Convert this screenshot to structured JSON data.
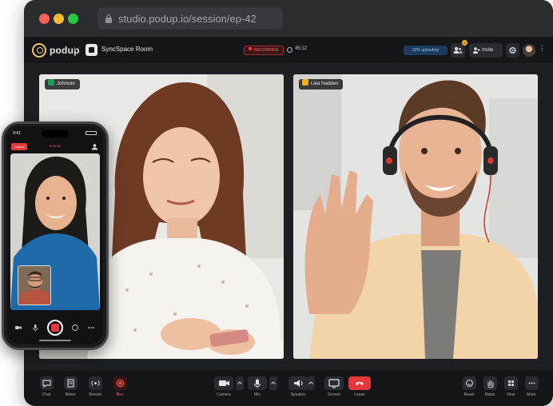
{
  "browser": {
    "url": "studio.podup.io/session/ep-42"
  },
  "app": {
    "logo_text": "podup",
    "breadcrumb_separator": "›",
    "room_name": "SyncSpace Room",
    "recording_label": "RECORDING",
    "timer": "45:12",
    "upload_status": "32% uploading",
    "notification_count": "3",
    "invite_label": "Invite",
    "more_label": "⋮"
  },
  "participants": [
    {
      "name": "Johnson",
      "mic_color": "#1f9d55"
    },
    {
      "name": "Liea Hadden",
      "mic_color": "#f2b01e"
    }
  ],
  "controls": {
    "left": [
      {
        "label": "Chat",
        "icon": "chat-icon"
      },
      {
        "label": "Notes",
        "icon": "notes-icon"
      },
      {
        "label": "Stream",
        "icon": "stream-icon"
      },
      {
        "label": "Rec",
        "icon": "record-icon"
      }
    ],
    "center": [
      {
        "label": "Camera",
        "icon": "camera-icon"
      },
      {
        "label": "Mic",
        "icon": "mic-icon"
      },
      {
        "label": "Speaker",
        "icon": "speaker-icon"
      },
      {
        "label": "Screen",
        "icon": "screen-share-icon"
      },
      {
        "label": "Leave",
        "icon": "leave-call-icon"
      }
    ],
    "right": [
      {
        "label": "React",
        "icon": "react-icon"
      },
      {
        "label": "Raise",
        "icon": "raise-hand-icon"
      },
      {
        "label": "View",
        "icon": "view-grid-icon"
      },
      {
        "label": "More",
        "icon": "more-icon"
      }
    ]
  },
  "phone": {
    "time": "9:41",
    "cancel_label": "Cancel",
    "rec_label": "● 00:36"
  },
  "colors": {
    "accent": "#e8c46a",
    "leave": "#e5383b",
    "recording": "#ff3b3b",
    "upload": "#8ec3ff"
  }
}
